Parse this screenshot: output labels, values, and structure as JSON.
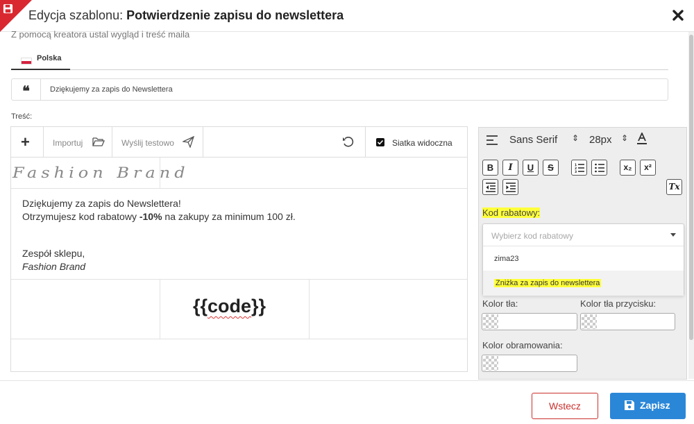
{
  "header": {
    "title_prefix": "Edycja szablonu:",
    "title_main": "Potwierdzenie zapisu do newslettera"
  },
  "subtitle": "Z pomocą kreatora ustal wygląd i treść maila",
  "tabs": [
    {
      "label": "Polska"
    }
  ],
  "subject": {
    "value": "Dziękujemy za zapis do Newslettera"
  },
  "content_label": "Treść:",
  "editor_toolbar": {
    "import_label": "Importuj",
    "send_test_label": "Wyślij testowo",
    "grid_visible_label": "Siatka widoczna",
    "grid_visible_checked": true
  },
  "email": {
    "logo_text": "Fashion Brand",
    "line1": "Dziękujemy za zapis do Newslettera!",
    "line2_prefix": "Otrzymujesz kod rabatowy ",
    "line2_bold": "-10%",
    "line2_suffix": " na zakupy za minimum 100 zł.",
    "signoff": "Zespół sklepu,",
    "signature": "Fashion Brand",
    "code_open": "{{",
    "code_word": "code",
    "code_close": "}}"
  },
  "format_panel": {
    "font_family": "Sans Serif",
    "font_size": "28px",
    "buttons": {
      "bold": "B",
      "italic": "I",
      "underline": "U",
      "strike": "S",
      "subscript": "x₂",
      "superscript": "x²",
      "clear": "Tx"
    },
    "discount_code_label": "Kod rabatowy:",
    "discount_placeholder": "Wybierz kod rabatowy",
    "discount_options": [
      "zima23",
      "Zniżka za zapis do newslettera"
    ],
    "bg_color_label": "Kolor tła:",
    "button_bg_color_label": "Kolor tła przycisku:",
    "border_color_label": "Kolor obramowania:"
  },
  "footer": {
    "back_label": "Wstecz",
    "save_label": "Zapisz"
  },
  "colors": {
    "accent": "#2a87d8",
    "danger": "#c9302c",
    "highlight": "#ffff3a",
    "corner": "#d9282f"
  }
}
